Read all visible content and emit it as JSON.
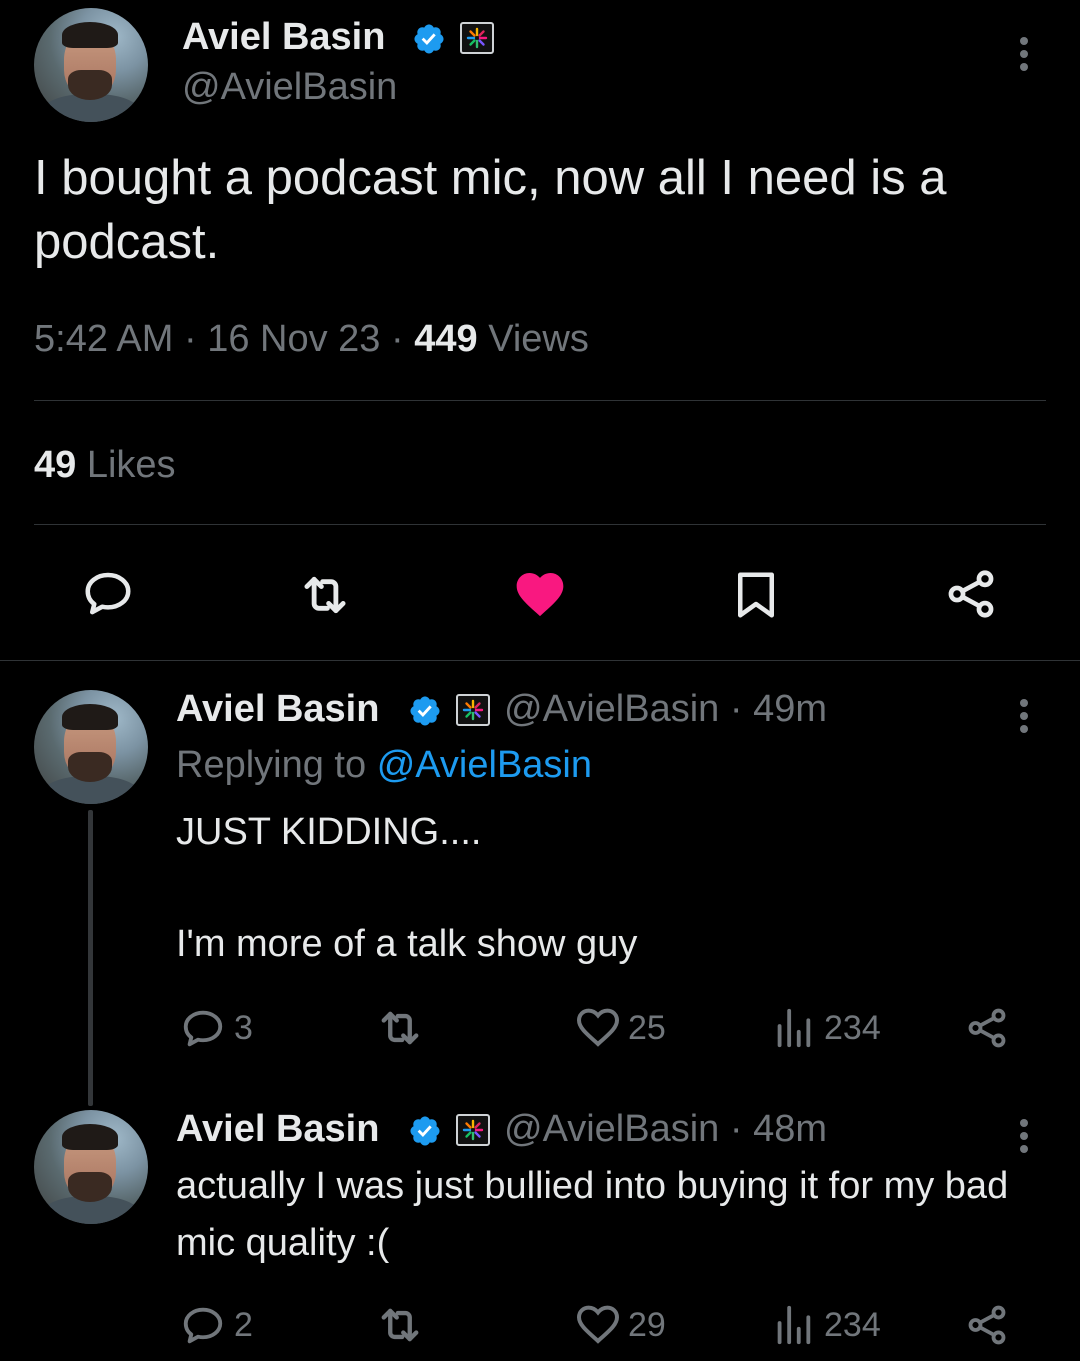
{
  "colors": {
    "background": "#000000",
    "text": "#e7e9ea",
    "muted": "#71767b",
    "link": "#1d9bf0",
    "like": "#f91880",
    "divider": "#2f3336"
  },
  "main_tweet": {
    "author_name": "Aviel Basin",
    "author_handle": "@AvielBasin",
    "text": "I bought a podcast mic, now all I need is a podcast.",
    "time": "5:42 AM",
    "date": "16 Nov 23",
    "views_count": "449",
    "views_label": "Views",
    "likes_count": "49",
    "likes_label": "Likes",
    "actions": [
      "reply-icon",
      "retweet-icon",
      "like-icon-filled",
      "bookmark-icon",
      "share-icon"
    ]
  },
  "replies": [
    {
      "author_name": "Aviel Basin",
      "author_handle": "@AvielBasin",
      "age": "49m",
      "replying_prefix": "Replying to",
      "replying_handle": "@AvielBasin",
      "text_line1": "JUST KIDDING....",
      "text_line2": "I'm more of a talk show guy",
      "reply_count": "3",
      "like_count": "25",
      "view_count": "234"
    },
    {
      "author_name": "Aviel Basin",
      "author_handle": "@AvielBasin",
      "age": "48m",
      "text": "actually I was just bullied into buying it for my bad mic quality :(",
      "reply_count": "2",
      "like_count": "29",
      "view_count": "234"
    }
  ]
}
